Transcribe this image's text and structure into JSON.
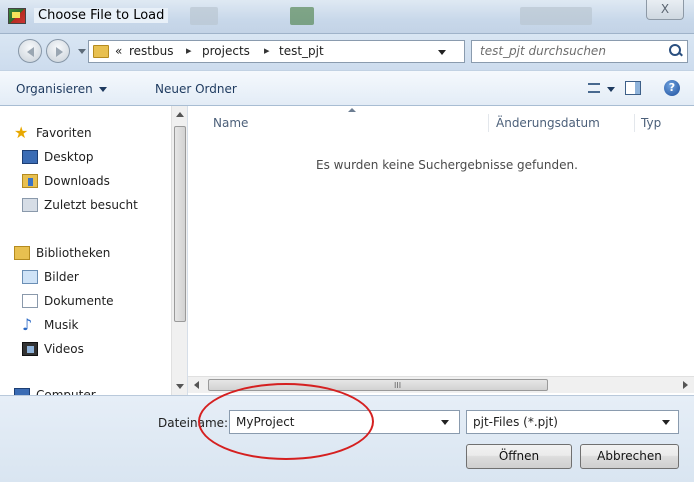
{
  "window": {
    "title": "Choose File to Load",
    "close_label": "X"
  },
  "address": {
    "crumbs": [
      "restbus",
      "projects",
      "test_pjt"
    ],
    "overflow": "«",
    "search_placeholder": "test_pjt durchsuchen"
  },
  "toolbar": {
    "organize": "Organisieren",
    "new_folder": "Neuer Ordner"
  },
  "nav": {
    "favorites": "Favoriten",
    "desktop": "Desktop",
    "downloads": "Downloads",
    "recent": "Zuletzt besucht",
    "libraries": "Bibliotheken",
    "pictures": "Bilder",
    "documents": "Dokumente",
    "music": "Musik",
    "videos": "Videos",
    "computer": "Computer"
  },
  "columns": {
    "name": "Name",
    "modified": "Änderungsdatum",
    "type": "Typ"
  },
  "empty_message": "Es wurden keine Suchergebnisse gefunden.",
  "footer": {
    "filename_label": "Dateiname:",
    "filename_value": "MyProject",
    "filetype": "pjt-Files (*.pjt)",
    "open": "Öffnen",
    "cancel": "Abbrechen"
  },
  "annotation_color": "#d52020"
}
